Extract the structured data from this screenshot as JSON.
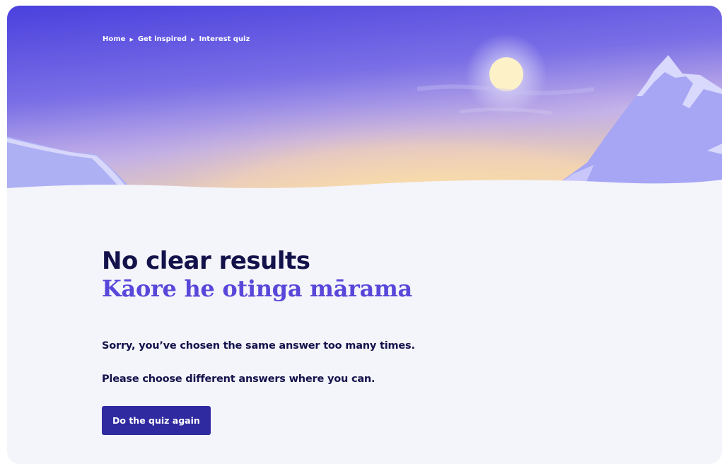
{
  "breadcrumb": {
    "items": [
      "Home",
      "Get inspired",
      "Interest quiz"
    ],
    "separator_icon": "triangle-right-icon"
  },
  "heading": {
    "english": "No clear results",
    "maori": "Kāore he otinga mārama"
  },
  "messages": {
    "line1": "Sorry, you’ve chosen the same answer too many times.",
    "line2": "Please choose different answers where you can."
  },
  "actions": {
    "retry_label": "Do the quiz again"
  },
  "colors": {
    "sky_top": "#4f43df",
    "sky_glow": "#f8dfa6",
    "snow": "#f4f4fb",
    "mountain": "#a7a7f5",
    "heading_dark": "#14124a",
    "heading_accent": "#5847d9",
    "button": "#2f2aa0"
  }
}
